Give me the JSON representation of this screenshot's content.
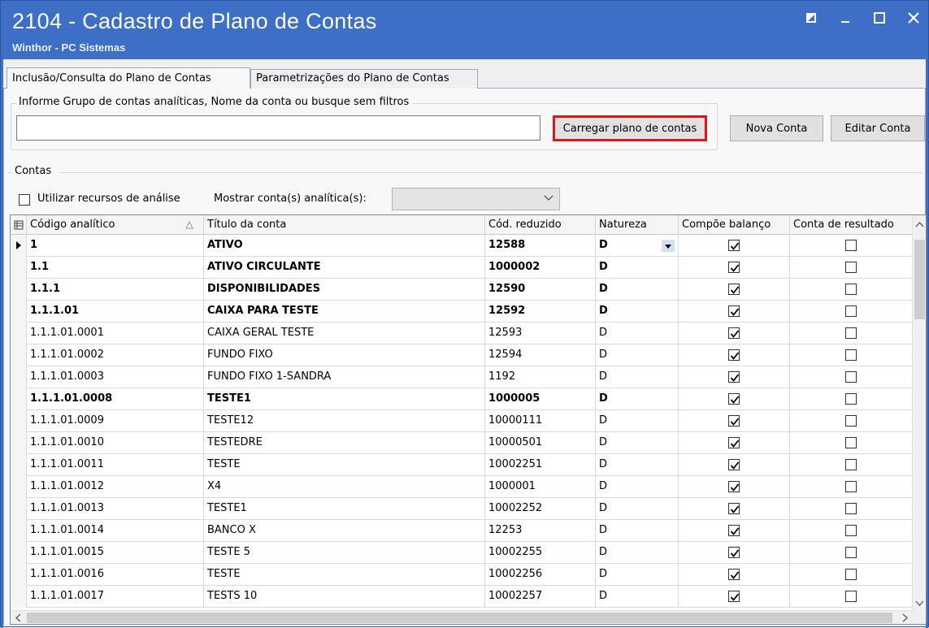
{
  "window": {
    "title": "2104 - Cadastro de Plano de Contas",
    "subtitle": "Winthor - PC Sistemas",
    "controls": [
      "restore-icon",
      "minimize-icon",
      "maximize-icon",
      "close-icon"
    ]
  },
  "tabs": [
    {
      "label": "Inclusão/Consulta do Plano de Contas",
      "active": true
    },
    {
      "label": "Parametrizações do Plano de Contas",
      "active": false
    }
  ],
  "search": {
    "group_label": "Informe Grupo de contas analíticas, Nome da conta ou busque sem filtros",
    "value": "",
    "load_button": "Carregar plano de contas",
    "new_button": "Nova Conta",
    "edit_button": "Editar Conta",
    "highlight_color": "#e0141a"
  },
  "contas": {
    "section_label": "Contas",
    "analysis_label": "Utilizar recursos de análise",
    "analysis_checked": false,
    "show_label": "Mostrar conta(s) analítica(s):",
    "show_value": ""
  },
  "grid": {
    "columns": [
      "Código analítico",
      "Título da conta",
      "Cód. reduzido",
      "Natureza",
      "Compõe balanço",
      "Conta de resultado"
    ],
    "rows": [
      {
        "codigo": "1",
        "titulo": "ATIVO",
        "reduzido": "12588",
        "natureza": "D",
        "balanco": true,
        "resultado": false,
        "bold": true,
        "current": true
      },
      {
        "codigo": "1.1",
        "titulo": "ATIVO CIRCULANTE",
        "reduzido": "1000002",
        "natureza": "D",
        "balanco": true,
        "resultado": false,
        "bold": true
      },
      {
        "codigo": "1.1.1",
        "titulo": "DISPONIBILIDADES",
        "reduzido": "12590",
        "natureza": "D",
        "balanco": true,
        "resultado": false,
        "bold": true
      },
      {
        "codigo": "1.1.1.01",
        "titulo": "CAIXA PARA TESTE",
        "reduzido": "12592",
        "natureza": "D",
        "balanco": true,
        "resultado": false,
        "bold": true
      },
      {
        "codigo": "1.1.1.01.0001",
        "titulo": "CAIXA GERAL TESTE",
        "reduzido": "12593",
        "natureza": "D",
        "balanco": true,
        "resultado": false,
        "bold": false
      },
      {
        "codigo": "1.1.1.01.0002",
        "titulo": "FUNDO FIXO",
        "reduzido": "12594",
        "natureza": "D",
        "balanco": true,
        "resultado": false,
        "bold": false
      },
      {
        "codigo": "1.1.1.01.0003",
        "titulo": "FUNDO FIXO 1-SANDRA",
        "reduzido": "1192",
        "natureza": "D",
        "balanco": true,
        "resultado": false,
        "bold": false
      },
      {
        "codigo": "1.1.1.01.0008",
        "titulo": "TESTE1",
        "reduzido": "1000005",
        "natureza": "D",
        "balanco": true,
        "resultado": false,
        "bold": true
      },
      {
        "codigo": "1.1.1.01.0009",
        "titulo": "TESTE12",
        "reduzido": "10000111",
        "natureza": "D",
        "balanco": true,
        "resultado": false,
        "bold": false
      },
      {
        "codigo": "1.1.1.01.0010",
        "titulo": "TESTEDRE",
        "reduzido": "10000501",
        "natureza": "D",
        "balanco": true,
        "resultado": false,
        "bold": false
      },
      {
        "codigo": "1.1.1.01.0011",
        "titulo": "TESTE",
        "reduzido": "10002251",
        "natureza": "D",
        "balanco": true,
        "resultado": false,
        "bold": false
      },
      {
        "codigo": "1.1.1.01.0012",
        "titulo": "X4",
        "reduzido": "1000001",
        "natureza": "D",
        "balanco": true,
        "resultado": false,
        "bold": false
      },
      {
        "codigo": "1.1.1.01.0013",
        "titulo": "TESTE1",
        "reduzido": "10002252",
        "natureza": "D",
        "balanco": true,
        "resultado": false,
        "bold": false
      },
      {
        "codigo": "1.1.1.01.0014",
        "titulo": "BANCO X",
        "reduzido": "12253",
        "natureza": "D",
        "balanco": true,
        "resultado": false,
        "bold": false
      },
      {
        "codigo": "1.1.1.01.0015",
        "titulo": "TESTE 5",
        "reduzido": "10002255",
        "natureza": "D",
        "balanco": true,
        "resultado": false,
        "bold": false
      },
      {
        "codigo": "1.1.1.01.0016",
        "titulo": "TESTE",
        "reduzido": "10002256",
        "natureza": "D",
        "balanco": true,
        "resultado": false,
        "bold": false
      },
      {
        "codigo": "1.1.1.01.0017",
        "titulo": "TESTS 10",
        "reduzido": "10002257",
        "natureza": "D",
        "balanco": true,
        "resultado": false,
        "bold": false
      }
    ]
  }
}
